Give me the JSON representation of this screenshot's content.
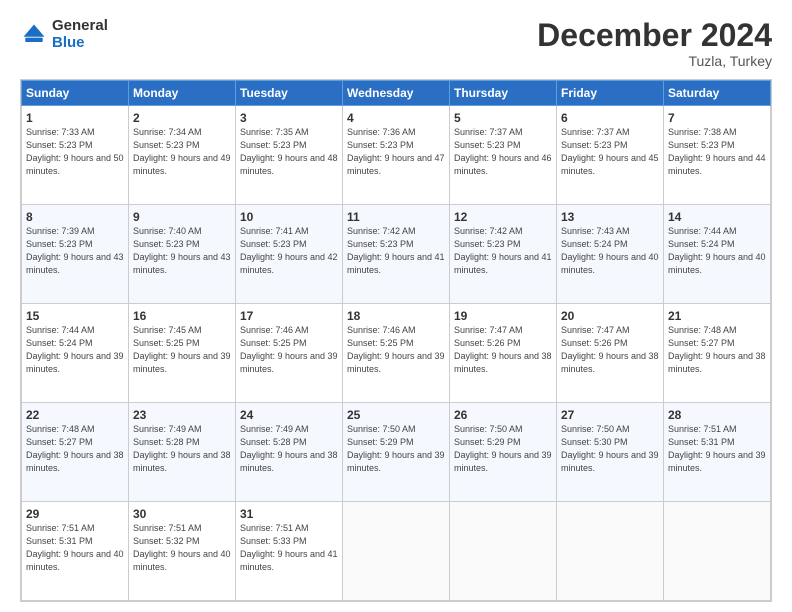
{
  "header": {
    "logo_line1": "General",
    "logo_line2": "Blue",
    "title": "December 2024",
    "location": "Tuzla, Turkey"
  },
  "weekdays": [
    "Sunday",
    "Monday",
    "Tuesday",
    "Wednesday",
    "Thursday",
    "Friday",
    "Saturday"
  ],
  "weeks": [
    [
      {
        "day": "1",
        "sunrise": "Sunrise: 7:33 AM",
        "sunset": "Sunset: 5:23 PM",
        "daylight": "Daylight: 9 hours and 50 minutes."
      },
      {
        "day": "2",
        "sunrise": "Sunrise: 7:34 AM",
        "sunset": "Sunset: 5:23 PM",
        "daylight": "Daylight: 9 hours and 49 minutes."
      },
      {
        "day": "3",
        "sunrise": "Sunrise: 7:35 AM",
        "sunset": "Sunset: 5:23 PM",
        "daylight": "Daylight: 9 hours and 48 minutes."
      },
      {
        "day": "4",
        "sunrise": "Sunrise: 7:36 AM",
        "sunset": "Sunset: 5:23 PM",
        "daylight": "Daylight: 9 hours and 47 minutes."
      },
      {
        "day": "5",
        "sunrise": "Sunrise: 7:37 AM",
        "sunset": "Sunset: 5:23 PM",
        "daylight": "Daylight: 9 hours and 46 minutes."
      },
      {
        "day": "6",
        "sunrise": "Sunrise: 7:37 AM",
        "sunset": "Sunset: 5:23 PM",
        "daylight": "Daylight: 9 hours and 45 minutes."
      },
      {
        "day": "7",
        "sunrise": "Sunrise: 7:38 AM",
        "sunset": "Sunset: 5:23 PM",
        "daylight": "Daylight: 9 hours and 44 minutes."
      }
    ],
    [
      {
        "day": "8",
        "sunrise": "Sunrise: 7:39 AM",
        "sunset": "Sunset: 5:23 PM",
        "daylight": "Daylight: 9 hours and 43 minutes."
      },
      {
        "day": "9",
        "sunrise": "Sunrise: 7:40 AM",
        "sunset": "Sunset: 5:23 PM",
        "daylight": "Daylight: 9 hours and 43 minutes."
      },
      {
        "day": "10",
        "sunrise": "Sunrise: 7:41 AM",
        "sunset": "Sunset: 5:23 PM",
        "daylight": "Daylight: 9 hours and 42 minutes."
      },
      {
        "day": "11",
        "sunrise": "Sunrise: 7:42 AM",
        "sunset": "Sunset: 5:23 PM",
        "daylight": "Daylight: 9 hours and 41 minutes."
      },
      {
        "day": "12",
        "sunrise": "Sunrise: 7:42 AM",
        "sunset": "Sunset: 5:23 PM",
        "daylight": "Daylight: 9 hours and 41 minutes."
      },
      {
        "day": "13",
        "sunrise": "Sunrise: 7:43 AM",
        "sunset": "Sunset: 5:24 PM",
        "daylight": "Daylight: 9 hours and 40 minutes."
      },
      {
        "day": "14",
        "sunrise": "Sunrise: 7:44 AM",
        "sunset": "Sunset: 5:24 PM",
        "daylight": "Daylight: 9 hours and 40 minutes."
      }
    ],
    [
      {
        "day": "15",
        "sunrise": "Sunrise: 7:44 AM",
        "sunset": "Sunset: 5:24 PM",
        "daylight": "Daylight: 9 hours and 39 minutes."
      },
      {
        "day": "16",
        "sunrise": "Sunrise: 7:45 AM",
        "sunset": "Sunset: 5:25 PM",
        "daylight": "Daylight: 9 hours and 39 minutes."
      },
      {
        "day": "17",
        "sunrise": "Sunrise: 7:46 AM",
        "sunset": "Sunset: 5:25 PM",
        "daylight": "Daylight: 9 hours and 39 minutes."
      },
      {
        "day": "18",
        "sunrise": "Sunrise: 7:46 AM",
        "sunset": "Sunset: 5:25 PM",
        "daylight": "Daylight: 9 hours and 39 minutes."
      },
      {
        "day": "19",
        "sunrise": "Sunrise: 7:47 AM",
        "sunset": "Sunset: 5:26 PM",
        "daylight": "Daylight: 9 hours and 38 minutes."
      },
      {
        "day": "20",
        "sunrise": "Sunrise: 7:47 AM",
        "sunset": "Sunset: 5:26 PM",
        "daylight": "Daylight: 9 hours and 38 minutes."
      },
      {
        "day": "21",
        "sunrise": "Sunrise: 7:48 AM",
        "sunset": "Sunset: 5:27 PM",
        "daylight": "Daylight: 9 hours and 38 minutes."
      }
    ],
    [
      {
        "day": "22",
        "sunrise": "Sunrise: 7:48 AM",
        "sunset": "Sunset: 5:27 PM",
        "daylight": "Daylight: 9 hours and 38 minutes."
      },
      {
        "day": "23",
        "sunrise": "Sunrise: 7:49 AM",
        "sunset": "Sunset: 5:28 PM",
        "daylight": "Daylight: 9 hours and 38 minutes."
      },
      {
        "day": "24",
        "sunrise": "Sunrise: 7:49 AM",
        "sunset": "Sunset: 5:28 PM",
        "daylight": "Daylight: 9 hours and 38 minutes."
      },
      {
        "day": "25",
        "sunrise": "Sunrise: 7:50 AM",
        "sunset": "Sunset: 5:29 PM",
        "daylight": "Daylight: 9 hours and 39 minutes."
      },
      {
        "day": "26",
        "sunrise": "Sunrise: 7:50 AM",
        "sunset": "Sunset: 5:29 PM",
        "daylight": "Daylight: 9 hours and 39 minutes."
      },
      {
        "day": "27",
        "sunrise": "Sunrise: 7:50 AM",
        "sunset": "Sunset: 5:30 PM",
        "daylight": "Daylight: 9 hours and 39 minutes."
      },
      {
        "day": "28",
        "sunrise": "Sunrise: 7:51 AM",
        "sunset": "Sunset: 5:31 PM",
        "daylight": "Daylight: 9 hours and 39 minutes."
      }
    ],
    [
      {
        "day": "29",
        "sunrise": "Sunrise: 7:51 AM",
        "sunset": "Sunset: 5:31 PM",
        "daylight": "Daylight: 9 hours and 40 minutes."
      },
      {
        "day": "30",
        "sunrise": "Sunrise: 7:51 AM",
        "sunset": "Sunset: 5:32 PM",
        "daylight": "Daylight: 9 hours and 40 minutes."
      },
      {
        "day": "31",
        "sunrise": "Sunrise: 7:51 AM",
        "sunset": "Sunset: 5:33 PM",
        "daylight": "Daylight: 9 hours and 41 minutes."
      },
      null,
      null,
      null,
      null
    ]
  ]
}
